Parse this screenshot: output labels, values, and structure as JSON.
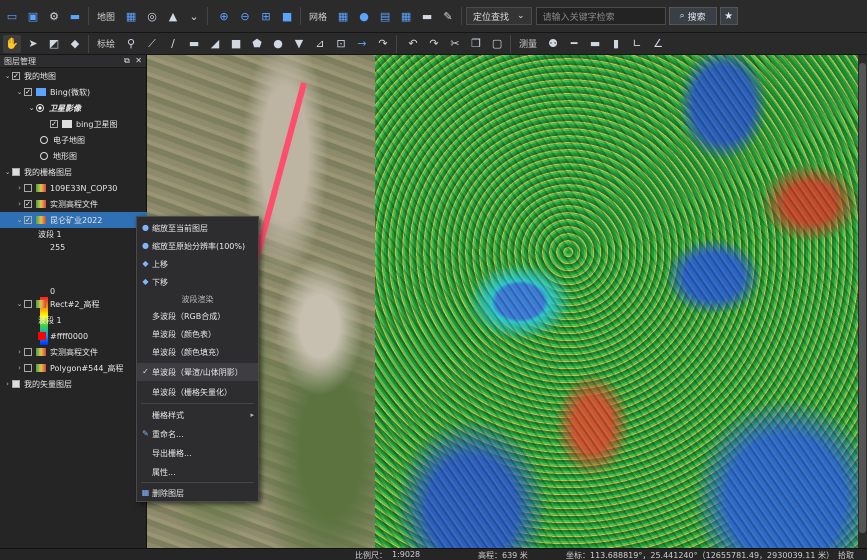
{
  "toolbar1": {
    "map_label": "地图",
    "grid_label": "网格",
    "locate_dropdown": "定位查找",
    "search_placeholder": "请输入关键字检索",
    "search_button": "搜索"
  },
  "toolbar2": {
    "mark_label": "标绘",
    "measure_label": "测量"
  },
  "panel": {
    "title": "图层管理",
    "tree": [
      {
        "label": "我的地图"
      },
      {
        "label": "Bing(微软)"
      },
      {
        "label": "卫星影像"
      },
      {
        "label": "bing卫星图"
      },
      {
        "label": "电子地图"
      },
      {
        "label": "地形图"
      },
      {
        "label": "我的栅格图层"
      },
      {
        "label": "109E33N_COP30"
      },
      {
        "label": "实测高程文件"
      },
      {
        "label": "昆仑矿业2022"
      },
      {
        "label": "波段 1"
      },
      {
        "label": "255"
      },
      {
        "label": "0"
      },
      {
        "label": "Rect#2_高程"
      },
      {
        "label": "波段 1"
      },
      {
        "label": "#ffff0000"
      },
      {
        "label": "实测高程文件"
      },
      {
        "label": "Polygon#544_高程"
      },
      {
        "label": "我的矢量图层"
      }
    ]
  },
  "context_menu": {
    "zoom_layer": "缩放至当前图层",
    "zoom_native": "缩放至原始分辨率(100%)",
    "move_up": "上移",
    "move_down": "下移",
    "band_render_header": "波段渲染",
    "multi_band": "多波段（RGB合成）",
    "single_band_table": "单波段（颜色表）",
    "single_band_fill": "单波段（颜色填充）",
    "single_band_hillshade": "单波段（晕渲/山体阴影）",
    "single_band_vector": "单波段（栅格矢量化）",
    "grid_style": "栅格样式",
    "rename": "重命名...",
    "export_grid": "导出栅格...",
    "properties": "属性...",
    "delete_layer": "删除图层"
  },
  "status": {
    "scale_label": "比例尺：",
    "scale_value": "1:9028",
    "elevation": "高程：639 米",
    "coords": "坐标：113.688819°，25.441240°（12655781.49，2930039.11 米）",
    "right": "拾取"
  },
  "colors": {
    "selection": "#2f6fb3",
    "arrow": "#ff4d6d",
    "accent": "#5aa3ff"
  }
}
